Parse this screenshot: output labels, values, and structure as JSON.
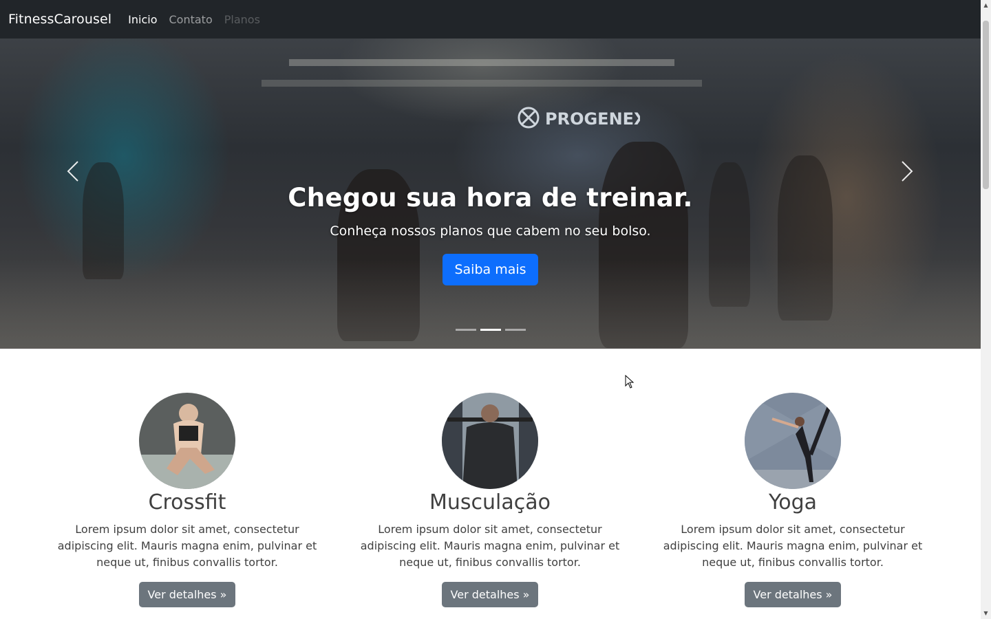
{
  "navbar": {
    "brand": "FitnessCarousel",
    "links": [
      {
        "label": "Inicio",
        "state": "active"
      },
      {
        "label": "Contato",
        "state": "normal"
      },
      {
        "label": "Planos",
        "state": "disabled"
      }
    ]
  },
  "carousel": {
    "heading": "Chegou sua hora de treinar.",
    "subheading": "Conheça nossos planos que cabem no seu bolso.",
    "cta_label": "Saiba mais",
    "indicator_count": 3,
    "active_indicator": 2,
    "background_sign": "PROGENEX"
  },
  "features": [
    {
      "title": "Crossfit",
      "text": "Lorem ipsum dolor sit amet, consectetur adipiscing elit. Mauris magna enim, pulvinar et neque ut, finibus convallis tortor.",
      "button": "Ver detalhes »"
    },
    {
      "title": "Musculação",
      "text": "Lorem ipsum dolor sit amet, consectetur adipiscing elit. Mauris magna enim, pulvinar et neque ut, finibus convallis tortor.",
      "button": "Ver detalhes »"
    },
    {
      "title": "Yoga",
      "text": "Lorem ipsum dolor sit amet, consectetur adipiscing elit. Mauris magna enim, pulvinar et neque ut, finibus convallis tortor.",
      "button": "Ver detalhes »"
    }
  ],
  "colors": {
    "navbar_bg": "#212529",
    "primary": "#0d6efd",
    "secondary": "#6c757d"
  }
}
